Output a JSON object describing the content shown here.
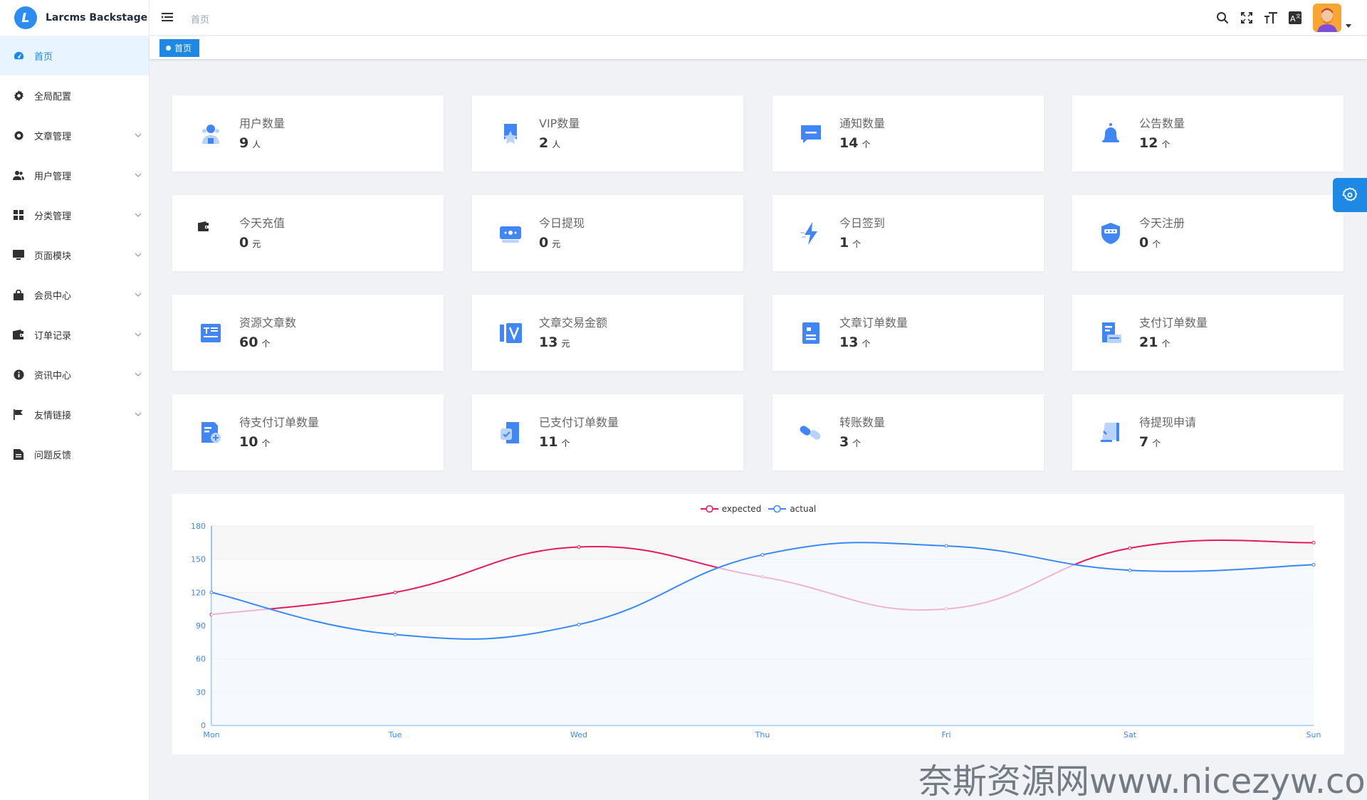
{
  "app": {
    "title": "Larcms Backstage",
    "logo_letter": "L",
    "accent_color": "#1e88e5"
  },
  "sidebar": {
    "items": [
      {
        "label": "首页",
        "icon": "dashboard-icon",
        "active": true
      },
      {
        "label": "全局配置",
        "icon": "gear-icon"
      },
      {
        "label": "文章管理",
        "icon": "lifebuoy-icon",
        "expandable": true
      },
      {
        "label": "用户管理",
        "icon": "users-icon",
        "expandable": true
      },
      {
        "label": "分类管理",
        "icon": "grid-icon",
        "expandable": true
      },
      {
        "label": "页面模块",
        "icon": "monitor-icon",
        "expandable": true
      },
      {
        "label": "会员中心",
        "icon": "shopping-bag-icon",
        "expandable": true
      },
      {
        "label": "订单记录",
        "icon": "wallet-icon",
        "expandable": true
      },
      {
        "label": "资讯中心",
        "icon": "info-icon",
        "expandable": true
      },
      {
        "label": "友情链接",
        "icon": "flag-icon",
        "expandable": true
      },
      {
        "label": "问题反馈",
        "icon": "document-icon"
      }
    ]
  },
  "header": {
    "breadcrumb": "首页",
    "icons": [
      "search-icon",
      "fullscreen-icon",
      "font-size-icon",
      "translate-icon"
    ]
  },
  "tags": {
    "active": "首页"
  },
  "stats": [
    {
      "title": "用户数量",
      "value": "9",
      "unit": "人",
      "icon": "user-icon"
    },
    {
      "title": "VIP数量",
      "value": "2",
      "unit": "人",
      "icon": "vip-badge-icon"
    },
    {
      "title": "通知数量",
      "value": "14",
      "unit": "个",
      "icon": "message-icon"
    },
    {
      "title": "公告数量",
      "value": "12",
      "unit": "个",
      "icon": "bell-icon"
    },
    {
      "title": "今天充值",
      "value": "0",
      "unit": "元",
      "icon": "wallet-icon"
    },
    {
      "title": "今日提现",
      "value": "0",
      "unit": "元",
      "icon": "cash-icon"
    },
    {
      "title": "今日签到",
      "value": "1",
      "unit": "个",
      "icon": "lightning-icon"
    },
    {
      "title": "今天注册",
      "value": "0",
      "unit": "个",
      "icon": "shield-icon"
    },
    {
      "title": "资源文章数",
      "value": "60",
      "unit": "个",
      "icon": "article-icon"
    },
    {
      "title": "文章交易金额",
      "value": "13",
      "unit": "元",
      "icon": "v-book-icon"
    },
    {
      "title": "文章订单数量",
      "value": "13",
      "unit": "个",
      "icon": "order-doc-icon"
    },
    {
      "title": "支付订单数量",
      "value": "21",
      "unit": "个",
      "icon": "receipt-icon"
    },
    {
      "title": "待支付订单数量",
      "value": "10",
      "unit": "个",
      "icon": "add-doc-icon"
    },
    {
      "title": "已支付订单数量",
      "value": "11",
      "unit": "个",
      "icon": "checked-doc-icon"
    },
    {
      "title": "转账数量",
      "value": "3",
      "unit": "个",
      "icon": "transfer-icon"
    },
    {
      "title": "待提现申请",
      "value": "7",
      "unit": "个",
      "icon": "withdraw-icon"
    }
  ],
  "chart_data": {
    "type": "line",
    "categories": [
      "Mon",
      "Tue",
      "Wed",
      "Thu",
      "Fri",
      "Sat",
      "Sun"
    ],
    "series": [
      {
        "name": "expected",
        "values": [
          100,
          120,
          161,
          134,
          105,
          160,
          165
        ],
        "color": "#e5195f"
      },
      {
        "name": "actual",
        "values": [
          120,
          82,
          91,
          154,
          162,
          140,
          145
        ],
        "color": "#3888fa"
      }
    ],
    "ylim": [
      0,
      180
    ],
    "yticks": [
      0,
      30,
      60,
      90,
      120,
      150,
      180
    ],
    "legend_position": "top-center",
    "smooth": true,
    "grid": true
  },
  "watermark": "奈斯资源网www.nicezyw.com"
}
